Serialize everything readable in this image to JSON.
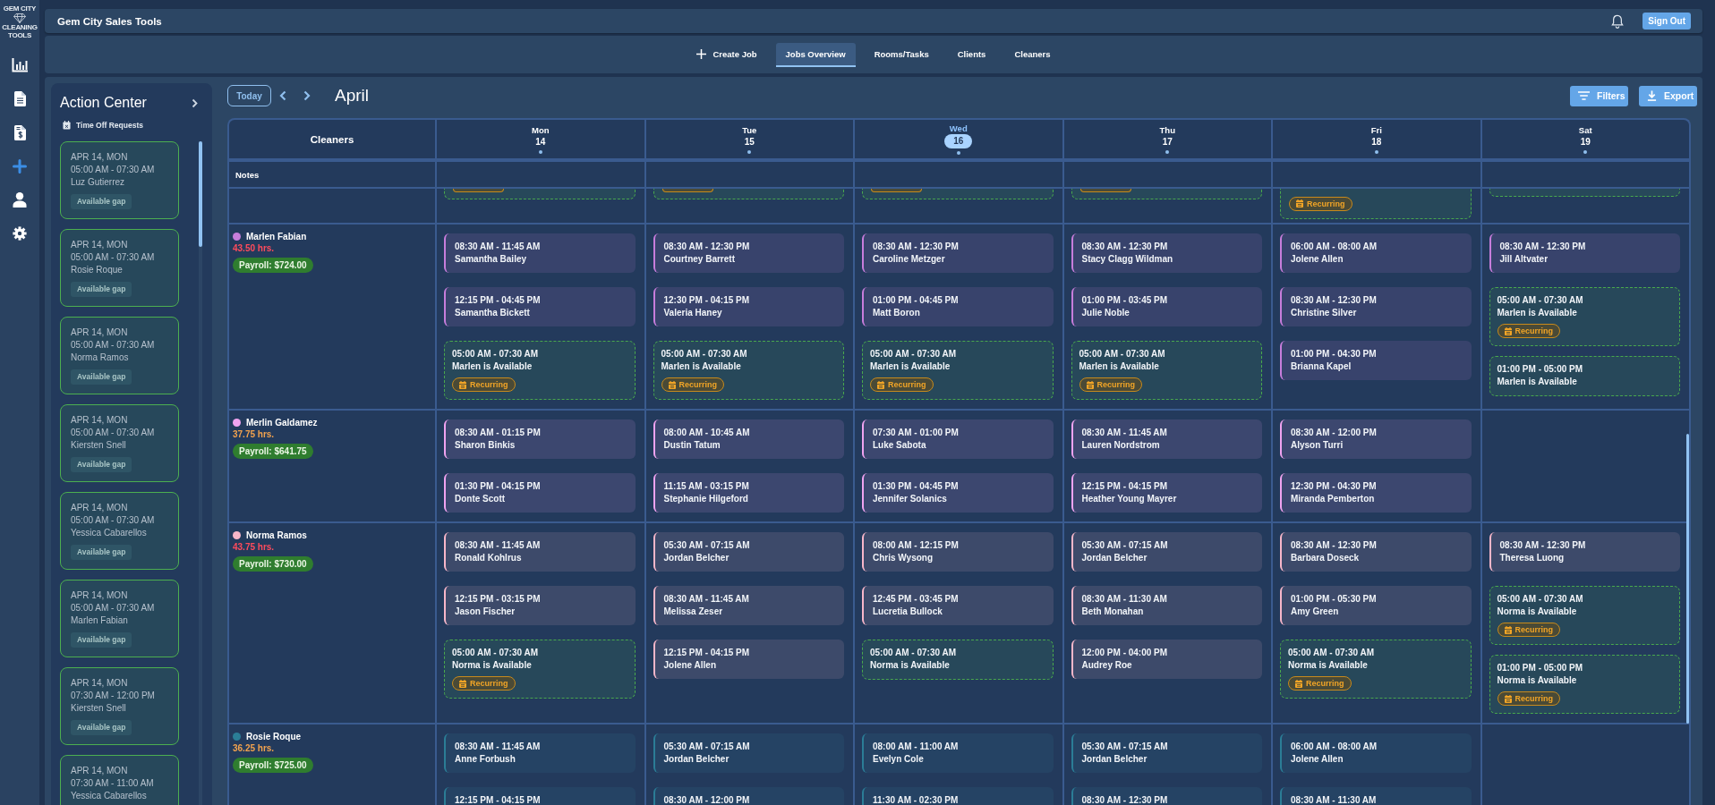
{
  "logo": {
    "top": "GEM CITY",
    "bottom": "CLEANING TOOLS"
  },
  "header": {
    "title": "Gem City Sales Tools",
    "sign_out": "Sign Out"
  },
  "nav": {
    "tabs": [
      {
        "label": "Create Job",
        "kind": "create",
        "selected": false
      },
      {
        "label": "Jobs Overview",
        "kind": "link",
        "selected": true
      },
      {
        "label": "Rooms/Tasks",
        "kind": "link",
        "selected": false
      },
      {
        "label": "Clients",
        "kind": "link",
        "selected": false
      },
      {
        "label": "Cleaners",
        "kind": "link",
        "selected": false
      }
    ]
  },
  "action_center": {
    "title": "Action Center",
    "section": "Time Off Requests",
    "requests": [
      {
        "date": "APR 14, MON",
        "time": "05:00 AM - 07:30 AM",
        "name": "Luz Gutierrez",
        "badge": "Available gap"
      },
      {
        "date": "APR 14, MON",
        "time": "05:00 AM - 07:30 AM",
        "name": "Rosie Roque",
        "badge": "Available gap"
      },
      {
        "date": "APR 14, MON",
        "time": "05:00 AM - 07:30 AM",
        "name": "Norma Ramos",
        "badge": "Available gap"
      },
      {
        "date": "APR 14, MON",
        "time": "05:00 AM - 07:30 AM",
        "name": "Kiersten Snell",
        "badge": "Available gap"
      },
      {
        "date": "APR 14, MON",
        "time": "05:00 AM - 07:30 AM",
        "name": "Yessica Cabarellos",
        "badge": "Available gap"
      },
      {
        "date": "APR 14, MON",
        "time": "05:00 AM - 07:30 AM",
        "name": "Marlen Fabian",
        "badge": "Available gap"
      },
      {
        "date": "APR 14, MON",
        "time": "07:30 AM - 12:00 PM",
        "name": "Kiersten Snell",
        "badge": "Available gap"
      },
      {
        "date": "APR 14, MON",
        "time": "07:30 AM - 11:00 AM",
        "name": "Yessica Cabarellos"
      }
    ]
  },
  "calendar": {
    "today": "Today",
    "month": "April",
    "filters": "Filters",
    "export": "Export",
    "corner": "Cleaners",
    "notes": "Notes",
    "days": [
      {
        "name": "Mon",
        "date": "14",
        "selected": false,
        "marker": true
      },
      {
        "name": "Tue",
        "date": "15",
        "selected": false,
        "marker": true
      },
      {
        "name": "Wed",
        "date": "16",
        "selected": true,
        "marker": true
      },
      {
        "name": "Thu",
        "date": "17",
        "selected": false,
        "marker": true
      },
      {
        "name": "Fri",
        "date": "18",
        "selected": false,
        "marker": true
      },
      {
        "name": "Sat",
        "date": "19",
        "selected": false,
        "marker": true
      }
    ],
    "cut_off_row": [
      {
        "kind": "badge-edge"
      },
      {
        "kind": "badge-edge"
      },
      {
        "kind": "badge-edge"
      },
      {
        "kind": "badge-edge"
      },
      {
        "kind": "badge",
        "badge": "Recurring"
      },
      {
        "kind": "edge"
      }
    ],
    "rows": [
      {
        "name": "Marlen Fabian",
        "color": "#c77ddb",
        "hours": "43.50 hrs.",
        "overtime": true,
        "payroll": "Payroll: $724.00",
        "cells": [
          [
            {
              "kind": "job",
              "time": "08:30 AM - 11:45 AM",
              "client": "Samantha Bailey"
            },
            {
              "kind": "job",
              "time": "12:15 PM - 04:45 PM",
              "client": "Samantha Bickett"
            },
            {
              "kind": "availability",
              "time": "05:00 AM - 07:30 AM",
              "text": "Marlen is Available",
              "badge": "Recurring"
            }
          ],
          [
            {
              "kind": "job",
              "time": "08:30 AM - 12:30 PM",
              "client": "Courtney Barrett"
            },
            {
              "kind": "job",
              "time": "12:30 PM - 04:15 PM",
              "client": "Valeria Haney"
            },
            {
              "kind": "availability",
              "time": "05:00 AM - 07:30 AM",
              "text": "Marlen is Available",
              "badge": "Recurring"
            }
          ],
          [
            {
              "kind": "job",
              "time": "08:30 AM - 12:30 PM",
              "client": "Caroline Metzger"
            },
            {
              "kind": "job",
              "time": "01:00 PM - 04:45 PM",
              "client": "Matt Boron"
            },
            {
              "kind": "availability",
              "time": "05:00 AM - 07:30 AM",
              "text": "Marlen is Available",
              "badge": "Recurring"
            }
          ],
          [
            {
              "kind": "job",
              "time": "08:30 AM - 12:30 PM",
              "client": "Stacy Clagg Wildman"
            },
            {
              "kind": "job",
              "time": "01:00 PM - 03:45 PM",
              "client": "Julie Noble"
            },
            {
              "kind": "availability",
              "time": "05:00 AM - 07:30 AM",
              "text": "Marlen is Available",
              "badge": "Recurring"
            }
          ],
          [
            {
              "kind": "job",
              "time": "06:00 AM - 08:00 AM",
              "client": "Jolene Allen"
            },
            {
              "kind": "job",
              "time": "08:30 AM - 12:30 PM",
              "client": "Christine Silver"
            },
            {
              "kind": "job",
              "time": "01:00 PM - 04:30 PM",
              "client": "Brianna Kapel"
            }
          ],
          [
            {
              "kind": "job",
              "time": "08:30 AM - 12:30 PM",
              "client": "Jill Altvater"
            },
            {
              "kind": "availability",
              "time": "05:00 AM - 07:30 AM",
              "text": "Marlen is Available",
              "badge": "Recurring"
            },
            {
              "kind": "availability",
              "time": "01:00 PM - 05:00 PM",
              "text": "Marlen is Available"
            }
          ]
        ]
      },
      {
        "name": "Merlin Galdamez",
        "color": "#f0a3f0",
        "hours": "37.75 hrs.",
        "overtime": false,
        "payroll": "Payroll: $641.75",
        "cells": [
          [
            {
              "kind": "job",
              "time": "08:30 AM - 01:15 PM",
              "client": "Sharon Binkis"
            },
            {
              "kind": "job",
              "time": "01:30 PM - 04:15 PM",
              "client": "Donte Scott"
            }
          ],
          [
            {
              "kind": "job",
              "time": "08:00 AM - 10:45 AM",
              "client": "Dustin Tatum"
            },
            {
              "kind": "job",
              "time": "11:15 AM - 03:15 PM",
              "client": "Stephanie Hilgeford"
            }
          ],
          [
            {
              "kind": "job",
              "time": "07:30 AM - 01:00 PM",
              "client": "Luke Sabota"
            },
            {
              "kind": "job",
              "time": "01:30 PM - 04:45 PM",
              "client": "Jennifer Solanics"
            }
          ],
          [
            {
              "kind": "job",
              "time": "08:30 AM - 11:45 AM",
              "client": "Lauren Nordstrom"
            },
            {
              "kind": "job",
              "time": "12:15 PM - 04:15 PM",
              "client": "Heather Young Mayrer"
            }
          ],
          [
            {
              "kind": "job",
              "time": "08:30 AM - 12:00 PM",
              "client": "Alyson Turri"
            },
            {
              "kind": "job",
              "time": "12:30 PM - 04:30 PM",
              "client": "Miranda Pemberton"
            }
          ],
          []
        ]
      },
      {
        "name": "Norma Ramos",
        "color": "#f7b6c9",
        "hours": "43.75 hrs.",
        "overtime": true,
        "payroll": "Payroll: $730.00",
        "cells": [
          [
            {
              "kind": "job",
              "time": "08:30 AM - 11:45 AM",
              "client": "Ronald Kohlrus"
            },
            {
              "kind": "job",
              "time": "12:15 PM - 03:15 PM",
              "client": "Jason Fischer"
            },
            {
              "kind": "availability",
              "time": "05:00 AM - 07:30 AM",
              "text": "Norma is Available",
              "badge": "Recurring"
            }
          ],
          [
            {
              "kind": "job",
              "time": "05:30 AM - 07:15 AM",
              "client": "Jordan Belcher"
            },
            {
              "kind": "job",
              "time": "08:30 AM - 11:45 AM",
              "client": "Melissa Zeser"
            },
            {
              "kind": "job",
              "time": "12:15 PM - 04:15 PM",
              "client": "Jolene Allen"
            }
          ],
          [
            {
              "kind": "job",
              "time": "08:00 AM - 12:15 PM",
              "client": "Chris Wysong"
            },
            {
              "kind": "job",
              "time": "12:45 PM - 03:45 PM",
              "client": "Lucretia Bullock"
            },
            {
              "kind": "availability",
              "time": "05:00 AM - 07:30 AM",
              "text": "Norma is Available"
            }
          ],
          [
            {
              "kind": "job",
              "time": "05:30 AM - 07:15 AM",
              "client": "Jordan Belcher"
            },
            {
              "kind": "job",
              "time": "08:30 AM - 11:30 AM",
              "client": "Beth Monahan"
            },
            {
              "kind": "job",
              "time": "12:00 PM - 04:00 PM",
              "client": "Audrey Roe"
            }
          ],
          [
            {
              "kind": "job",
              "time": "08:30 AM - 12:30 PM",
              "client": "Barbara Doseck"
            },
            {
              "kind": "job",
              "time": "01:00 PM - 05:30 PM",
              "client": "Amy Green"
            },
            {
              "kind": "availability",
              "time": "05:00 AM - 07:30 AM",
              "text": "Norma is Available",
              "badge": "Recurring"
            }
          ],
          [
            {
              "kind": "job",
              "time": "08:30 AM - 12:30 PM",
              "client": "Theresa Luong"
            },
            {
              "kind": "availability",
              "time": "05:00 AM - 07:30 AM",
              "text": "Norma is Available",
              "badge": "Recurring"
            },
            {
              "kind": "availability",
              "time": "01:00 PM - 05:00 PM",
              "text": "Norma is Available",
              "badge": "Recurring"
            }
          ]
        ]
      },
      {
        "name": "Rosie Roque",
        "color": "#2b7d96",
        "hours": "36.25 hrs.",
        "overtime": false,
        "payroll": "Payroll: $725.00",
        "cells": [
          [
            {
              "kind": "job",
              "time": "08:30 AM - 11:45 AM",
              "client": "Anne Forbush"
            },
            {
              "kind": "job",
              "time": "12:15 PM - 04:15 PM"
            }
          ],
          [
            {
              "kind": "job",
              "time": "05:30 AM - 07:15 AM",
              "client": "Jordan Belcher"
            },
            {
              "kind": "job",
              "time": "08:30 AM - 12:00 PM"
            }
          ],
          [
            {
              "kind": "job",
              "time": "08:00 AM - 11:00 AM",
              "client": "Evelyn Cole"
            },
            {
              "kind": "job",
              "time": "11:30 AM - 02:30 PM"
            }
          ],
          [
            {
              "kind": "job",
              "time": "05:30 AM - 07:15 AM",
              "client": "Jordan Belcher"
            },
            {
              "kind": "job",
              "time": "08:30 AM - 12:30 PM"
            }
          ],
          [
            {
              "kind": "job",
              "time": "06:00 AM - 08:00 AM",
              "client": "Jolene Allen"
            },
            {
              "kind": "job",
              "time": "08:30 AM - 11:30 AM"
            }
          ],
          []
        ]
      }
    ]
  }
}
